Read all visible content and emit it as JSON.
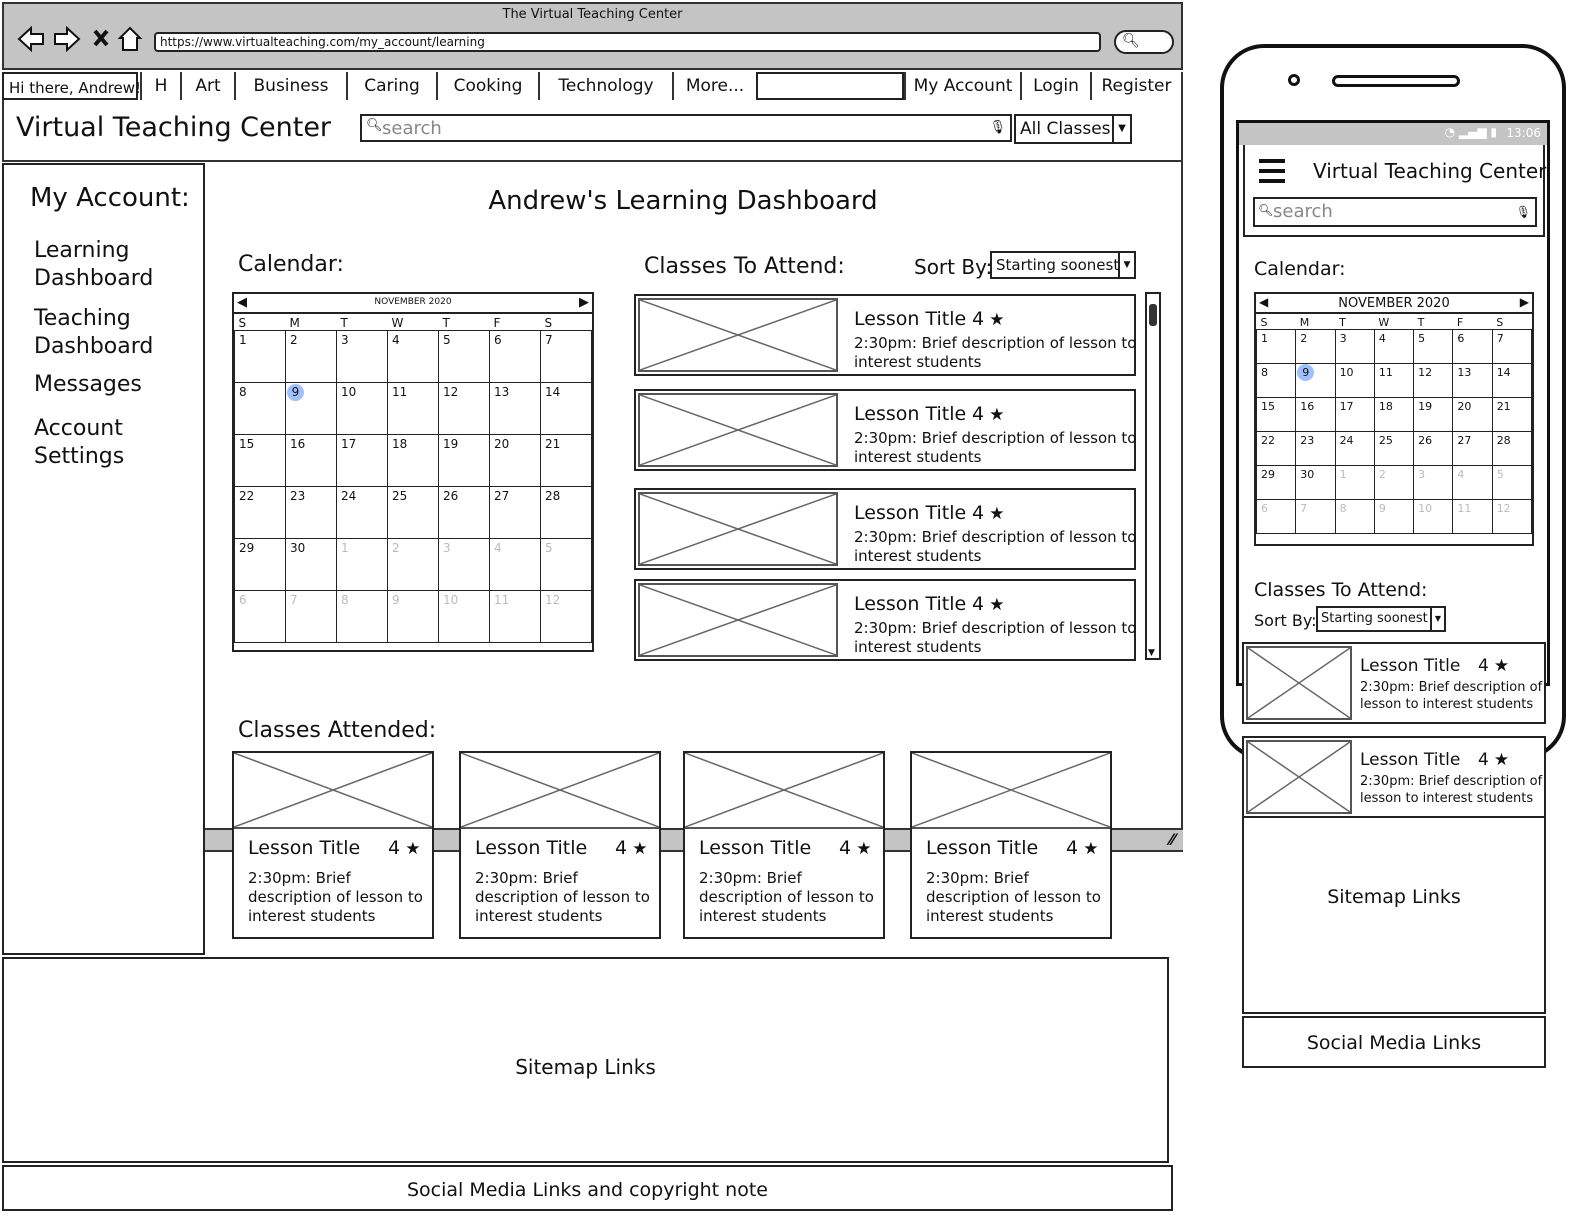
{
  "browser": {
    "title": "The Virtual Teaching Center",
    "url": "https://www.virtualteaching.com/my_account/learning"
  },
  "nav": {
    "greeting": "Hi there, Andrew!",
    "tabs": [
      "H",
      "Art",
      "Business",
      "Caring",
      "Cooking",
      "Technology",
      "More..."
    ],
    "account_links": [
      "My Account",
      "Login",
      "Register"
    ]
  },
  "header": {
    "site_name": "Virtual Teaching Center",
    "search_placeholder": "search",
    "class_filter": "All Classes"
  },
  "sidebar": {
    "title": "My Account:",
    "items": [
      {
        "line1": "Learning",
        "line2": "Dashboard"
      },
      {
        "line1": "Teaching",
        "line2": "Dashboard"
      },
      {
        "line1": "Messages",
        "line2": ""
      },
      {
        "line1": "Account",
        "line2": "Settings"
      }
    ]
  },
  "main": {
    "page_title": "Andrew's Learning Dashboard",
    "calendar_label": "Calendar:",
    "calendar_month": "NOVEMBER 2020",
    "weekdays": [
      "S",
      "M",
      "T",
      "W",
      "T",
      "F",
      "S"
    ],
    "calendar_rows": [
      [
        "1",
        "2",
        "3",
        "4",
        "5",
        "6",
        "7"
      ],
      [
        "8",
        "9",
        "10",
        "11",
        "12",
        "13",
        "14"
      ],
      [
        "15",
        "16",
        "17",
        "18",
        "19",
        "20",
        "21"
      ],
      [
        "22",
        "23",
        "24",
        "25",
        "26",
        "27",
        "28"
      ],
      [
        "29",
        "30",
        "1",
        "2",
        "3",
        "4",
        "5"
      ],
      [
        "6",
        "7",
        "8",
        "9",
        "10",
        "11",
        "12"
      ]
    ],
    "selected_day": "9",
    "classes_to_attend_label": "Classes To Attend:",
    "sort_by_label": "Sort By:",
    "sort_value": "Starting soonest",
    "lessons_to_attend": [
      {
        "title": "Lesson Title",
        "rating": "4",
        "desc1": "2:30pm: Brief description of lesson to",
        "desc2": "interest students"
      },
      {
        "title": "Lesson Title",
        "rating": "4",
        "desc1": "2:30pm: Brief description of lesson to",
        "desc2": "interest students"
      },
      {
        "title": "Lesson Title",
        "rating": "4",
        "desc1": "2:30pm: Brief description of lesson to",
        "desc2": "interest students"
      },
      {
        "title": "Lesson Title",
        "rating": "4",
        "desc1": "2:30pm: Brief description of lesson to",
        "desc2": "interest students"
      }
    ],
    "classes_attended_label": "Classes Attended:",
    "lessons_attended": [
      {
        "title": "Lesson Title",
        "rating": "4",
        "desc1": "2:30pm: Brief",
        "desc2": "description of lesson to",
        "desc3": "interest students"
      },
      {
        "title": "Lesson Title",
        "rating": "4",
        "desc1": "2:30pm: Brief",
        "desc2": "description of lesson to",
        "desc3": "interest students"
      },
      {
        "title": "Lesson Title",
        "rating": "4",
        "desc1": "2:30pm: Brief",
        "desc2": "description of lesson to",
        "desc3": "interest students"
      },
      {
        "title": "Lesson Title",
        "rating": "4",
        "desc1": "2:30pm: Brief",
        "desc2": "description of lesson to",
        "desc3": "interest students"
      }
    ]
  },
  "footer": {
    "sitemap": "Sitemap Links",
    "social": "Social Media Links and copyright note"
  },
  "mobile": {
    "status_time": "13:06",
    "site_name": "Virtual Teaching Center",
    "search_placeholder": "search",
    "calendar_label": "Calendar:",
    "calendar_month": "NOVEMBER 2020",
    "classes_to_attend_label": "Classes To Attend:",
    "sort_by_label": "Sort By:",
    "sort_value": "Starting soonest",
    "lessons": [
      {
        "title": "Lesson Title",
        "rating": "4",
        "desc1": "2:30pm: Brief description of",
        "desc2": "lesson to interest students"
      },
      {
        "title": "Lesson Title",
        "rating": "4",
        "desc1": "2:30pm: Brief description of",
        "desc2": "lesson to interest students"
      }
    ],
    "sitemap": "Sitemap Links",
    "social": "Social Media Links"
  },
  "icons": {
    "back": "back-arrow-icon",
    "forward": "forward-arrow-icon",
    "stop": "close-icon",
    "home": "home-icon",
    "search": "search-icon",
    "mic": "microphone-icon",
    "star": "star-icon",
    "menu": "hamburger-menu-icon",
    "dropdown": "chevron-down-icon"
  },
  "colors": {
    "chrome": "#c4c4c4",
    "selected_day": "#9ec0ff"
  }
}
